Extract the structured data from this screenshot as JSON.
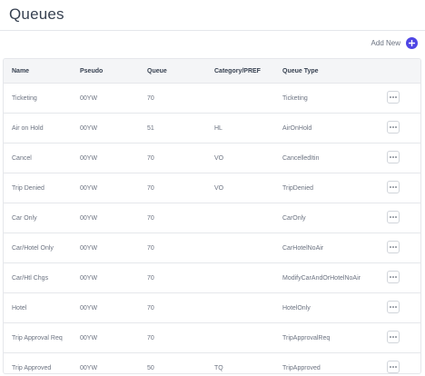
{
  "page": {
    "title": "Queues",
    "add_new_label": "Add New"
  },
  "table": {
    "headers": {
      "name": "Name",
      "pseudo": "Pseudo",
      "queue": "Queue",
      "category": "Category/PREF",
      "queue_type": "Queue Type"
    },
    "rows": [
      {
        "name": "Ticketing",
        "pseudo": "00YW",
        "queue": "70",
        "category": "",
        "queue_type": "Ticketing"
      },
      {
        "name": "Air on Hold",
        "pseudo": "00YW",
        "queue": "51",
        "category": "HL",
        "queue_type": "AirOnHold"
      },
      {
        "name": "Cancel",
        "pseudo": "00YW",
        "queue": "70",
        "category": "VO",
        "queue_type": "CancelledItin"
      },
      {
        "name": "Trip Denied",
        "pseudo": "00YW",
        "queue": "70",
        "category": "VO",
        "queue_type": "TripDenied"
      },
      {
        "name": "Car Only",
        "pseudo": "00YW",
        "queue": "70",
        "category": "",
        "queue_type": "CarOnly"
      },
      {
        "name": "Car/Hotel Only",
        "pseudo": "00YW",
        "queue": "70",
        "category": "",
        "queue_type": "CarHotelNoAir"
      },
      {
        "name": "Car/Htl Chgs",
        "pseudo": "00YW",
        "queue": "70",
        "category": "",
        "queue_type": "ModifyCarAndOrHotelNoAir"
      },
      {
        "name": "Hotel",
        "pseudo": "00YW",
        "queue": "70",
        "category": "",
        "queue_type": "HotelOnly"
      },
      {
        "name": "Trip Approval Req",
        "pseudo": "00YW",
        "queue": "70",
        "category": "",
        "queue_type": "TripApprovalReq"
      },
      {
        "name": "Trip Approved",
        "pseudo": "00YW",
        "queue": "50",
        "category": "TQ",
        "queue_type": "TripApproved"
      }
    ]
  },
  "icons": {
    "add": "plus-circle-icon",
    "more": "ellipsis-icon"
  },
  "colors": {
    "accent": "#4f46e5",
    "header_bg": "#f4f5f7",
    "border": "#e5e7eb"
  }
}
